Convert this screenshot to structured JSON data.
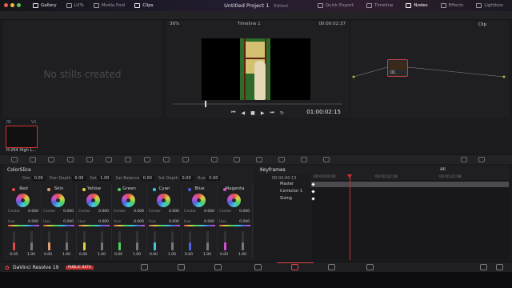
{
  "topbar": {
    "tabs": [
      {
        "label": "Gallery",
        "active": true
      },
      {
        "label": "LUTs",
        "active": false
      },
      {
        "label": "Media Pool",
        "active": false
      },
      {
        "label": "Clips",
        "active": true
      }
    ],
    "project_title": "Untitled Project 1",
    "edited_label": "Edited",
    "right_tabs": [
      {
        "label": "Quick Export",
        "active": false
      },
      {
        "label": "Timeline",
        "active": false
      },
      {
        "label": "Nodes",
        "active": true
      },
      {
        "label": "Effects",
        "active": false
      },
      {
        "label": "Lightbox",
        "active": false
      }
    ]
  },
  "gallery": {
    "empty_message": "No stills created"
  },
  "viewer": {
    "zoom": "36%",
    "timeline_name": "Timeline 1",
    "header_timecode": "00:00:02:37",
    "timecode": "01:00:02:15"
  },
  "nodes": {
    "mode": "Clip",
    "node_label": "01"
  },
  "clips": {
    "index": "01",
    "track": "V1",
    "clip_label": "H.264 High L..."
  },
  "colorslice": {
    "title": "ColorSlice",
    "params": [
      {
        "label": "Den",
        "value": "0.00"
      },
      {
        "label": "Den Depth",
        "value": "0.00"
      },
      {
        "label": "Sat",
        "value": "1.00"
      },
      {
        "label": "Sat Balance",
        "value": "0.00"
      },
      {
        "label": "Sat Depth",
        "value": "0.00"
      },
      {
        "label": "Hue",
        "value": "0.00"
      }
    ],
    "center_label": "Center",
    "hue_label": "Hue",
    "slices": [
      {
        "name": "Red",
        "color": "#e04848",
        "center": "0.000",
        "hue": "0.000"
      },
      {
        "name": "Skin",
        "color": "#e0a070",
        "center": "0.000",
        "hue": "0.000"
      },
      {
        "name": "Yellow",
        "color": "#e0d040",
        "center": "0.000",
        "hue": "0.000"
      },
      {
        "name": "Green",
        "color": "#50d060",
        "center": "0.000",
        "hue": "0.000"
      },
      {
        "name": "Cyan",
        "color": "#40c8e0",
        "center": "0.000",
        "hue": "0.000"
      },
      {
        "name": "Blue",
        "color": "#5060e0",
        "center": "0.000",
        "hue": "0.000"
      },
      {
        "name": "Magenta",
        "color": "#d050d0",
        "center": "0.000",
        "hue": "0.000"
      }
    ],
    "slider_values": [
      "-0.05",
      "1.00",
      "0.00",
      "1.00",
      "0.00",
      "1.00",
      "0.00",
      "1.00",
      "0.00",
      "1.00",
      "0.00",
      "1.00",
      "0.00",
      "1.00"
    ]
  },
  "keyframes": {
    "title": "Keyframes",
    "filter": "All",
    "timecode": "00:00:00:13",
    "ruler": [
      "00:00:00:00",
      "00:00:10:16",
      "00:00:21:08"
    ],
    "rows": [
      "Master",
      "Corrector 1",
      "Sizing"
    ]
  },
  "bottombar": {
    "app_name": "DaVinci Resolve 19",
    "badge": "PUBLIC BETA"
  }
}
